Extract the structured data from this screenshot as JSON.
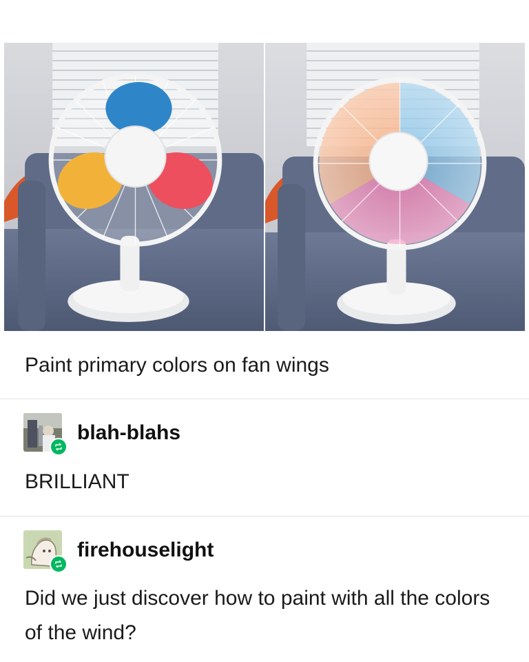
{
  "post": {
    "image_alt": "",
    "caption": "Paint primary colors on fan wings"
  },
  "reblogs": [
    {
      "username": "blah-blahs",
      "comment": "BRILLIANT",
      "avatar_icon": "photo-avatar-icon",
      "badge_icon": "reblog-icon",
      "badge_color": "#00b860"
    },
    {
      "username": "firehouselight",
      "comment": "Did we just discover how to paint with all the colors of the wind?",
      "avatar_icon": "cartoon-avatar-icon",
      "badge_icon": "reblog-icon",
      "badge_color": "#00b860"
    }
  ],
  "colors": {
    "blade_blue": "#2e86c8",
    "blade_yellow": "#f2b23a",
    "blade_red": "#ee4f5e",
    "couch": "#5d6a86"
  }
}
